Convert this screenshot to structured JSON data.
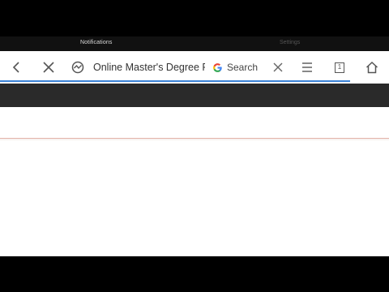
{
  "status_bar": {
    "notifications_label": "Notifications",
    "right_label": "Settings"
  },
  "toolbar": {
    "back_icon": "chevron-left-icon",
    "stop_icon": "close-icon",
    "site_icon": "site-identity-icon",
    "page_title": "Online Master's Degree Pr",
    "search_engine_icon": "google-g-icon",
    "search_label": "Search",
    "clear_icon": "close-icon",
    "menu_icon": "hamburger-menu-icon",
    "tabs_count": "1",
    "home_icon": "home-icon",
    "load_progress": 0.9
  },
  "colors": {
    "progress": "#3b82d6",
    "dark_band": "#2a2a2a",
    "accent_line": "#e4b4aa"
  }
}
